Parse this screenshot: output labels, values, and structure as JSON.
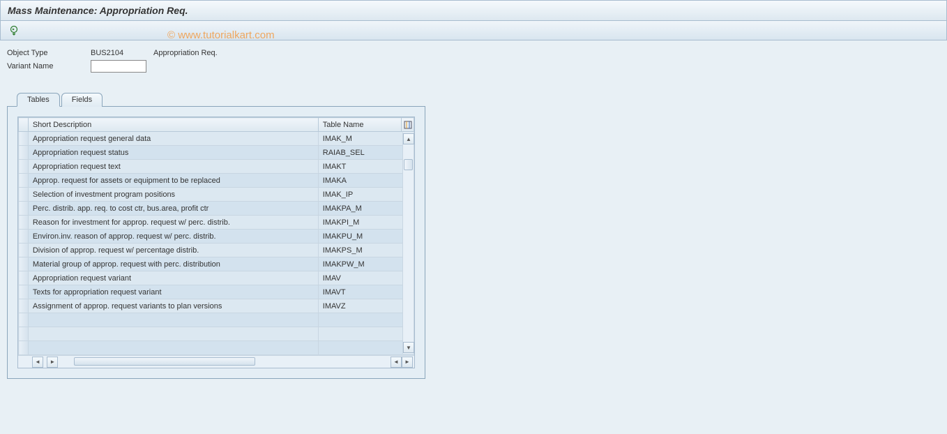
{
  "header": {
    "title": "Mass Maintenance: Appropriation Req."
  },
  "watermark": "© www.tutorialkart.com",
  "form": {
    "object_type_label": "Object Type",
    "object_type_value": "BUS2104",
    "object_type_desc": "Appropriation Req.",
    "variant_name_label": "Variant Name",
    "variant_name_value": ""
  },
  "tabs": {
    "tables": "Tables",
    "fields": "Fields"
  },
  "table": {
    "columns": {
      "short_desc": "Short Description",
      "table_name": "Table Name"
    },
    "rows": [
      {
        "desc": "Appropriation request general data",
        "name": "IMAK_M"
      },
      {
        "desc": "Appropriation request status",
        "name": "RAIAB_SEL"
      },
      {
        "desc": "Appropriation request text",
        "name": "IMAKT"
      },
      {
        "desc": "Approp. request for assets or equipment to be replaced",
        "name": "IMAKA"
      },
      {
        "desc": "Selection of investment program positions",
        "name": "IMAK_IP"
      },
      {
        "desc": "Perc. distrib. app. req. to cost ctr, bus.area, profit ctr",
        "name": "IMAKPA_M"
      },
      {
        "desc": "Reason for investment for approp. request w/ perc. distrib.",
        "name": "IMAKPI_M"
      },
      {
        "desc": "Environ.inv. reason of approp. request w/ perc. distrib.",
        "name": "IMAKPU_M"
      },
      {
        "desc": "Division of approp. request w/ percentage distrib.",
        "name": "IMAKPS_M"
      },
      {
        "desc": "Material group of approp. request with perc. distribution",
        "name": "IMAKPW_M"
      },
      {
        "desc": "Appropriation request variant",
        "name": "IMAV"
      },
      {
        "desc": "Texts for appropriation request variant",
        "name": "IMAVT"
      },
      {
        "desc": "Assignment of approp. request variants to plan versions",
        "name": "IMAVZ"
      }
    ]
  }
}
